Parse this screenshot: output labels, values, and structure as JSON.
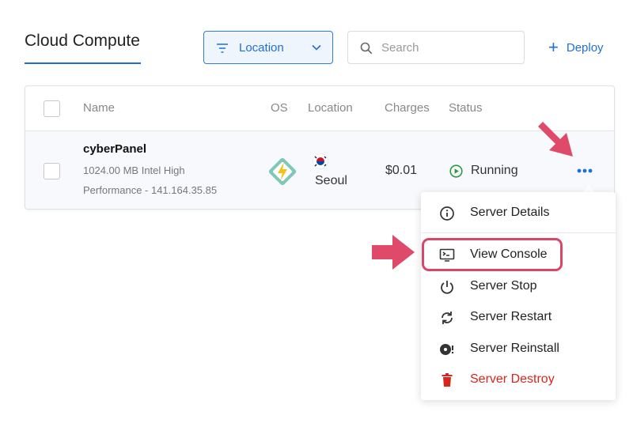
{
  "header": {
    "title": "Cloud Compute",
    "filter_label": "Location",
    "search_placeholder": "Search",
    "deploy_label": "Deploy"
  },
  "table": {
    "columns": [
      "Name",
      "OS",
      "Location",
      "Charges",
      "Status"
    ],
    "rows": [
      {
        "name": "cyberPanel",
        "spec_line1": "1024.00 MB Intel High",
        "spec_line2": "Performance - 141.164.35.85",
        "os_icon": "cyberpanel-logo-icon",
        "flag": "south-korea-flag-icon",
        "location": "Seoul",
        "charges": "$0.01",
        "status": "Running",
        "status_icon": "play-circle-icon"
      }
    ]
  },
  "menu": {
    "items": [
      {
        "label": "Server Details",
        "icon": "info-icon"
      },
      {
        "label": "View Console",
        "icon": "console-icon"
      },
      {
        "label": "Server Stop",
        "icon": "power-icon"
      },
      {
        "label": "Server Restart",
        "icon": "restart-icon"
      },
      {
        "label": "Server Reinstall",
        "icon": "reinstall-disc-icon"
      },
      {
        "label": "Server Destroy",
        "icon": "trash-icon"
      }
    ]
  },
  "colors": {
    "accent": "#1e6fd9",
    "highlight": "#d9466a",
    "running": "#2e9b3f",
    "danger": "#d9261c"
  }
}
